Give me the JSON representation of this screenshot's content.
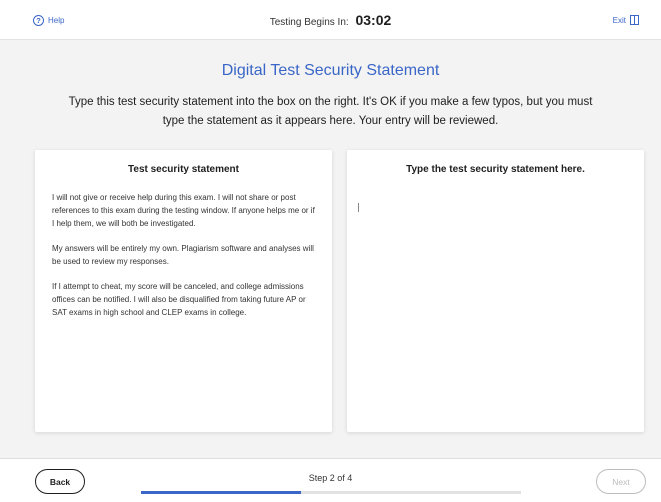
{
  "header": {
    "help_label": "Help",
    "timer_label": "Testing Begins In:",
    "timer_value": "03:02",
    "exit_label": "Exit"
  },
  "main": {
    "title": "Digital Test Security Statement",
    "instructions": "Type this test security statement into the box on the right. It's OK if you make a few typos, but you must type the statement as it appears here. Your entry will be reviewed.",
    "left_panel": {
      "heading": "Test security statement",
      "paragraphs": [
        "I will not give or receive help during this exam. I will not share or post references to this exam during the testing window. If anyone helps me or if I help them, we will both be investigated.",
        "My answers will be entirely my own. Plagiarism software and analyses will be used to review my responses.",
        "If I attempt to cheat, my score will be canceled, and college admissions offices can be notified. I will also be disqualified from taking future AP or SAT exams in high school and CLEP exams in college."
      ]
    },
    "right_panel": {
      "heading": "Type the test security statement here.",
      "entry_value": ""
    }
  },
  "footer": {
    "back_label": "Back",
    "step_label": "Step 2 of 4",
    "next_label": "Next",
    "progress_fraction": 0.42
  },
  "colors": {
    "accent": "#3a66c7",
    "background": "#f3f3f3",
    "disabled": "#bdbdbd"
  },
  "icons": {
    "help": "question-circle-icon",
    "exit": "door-exit-icon"
  }
}
